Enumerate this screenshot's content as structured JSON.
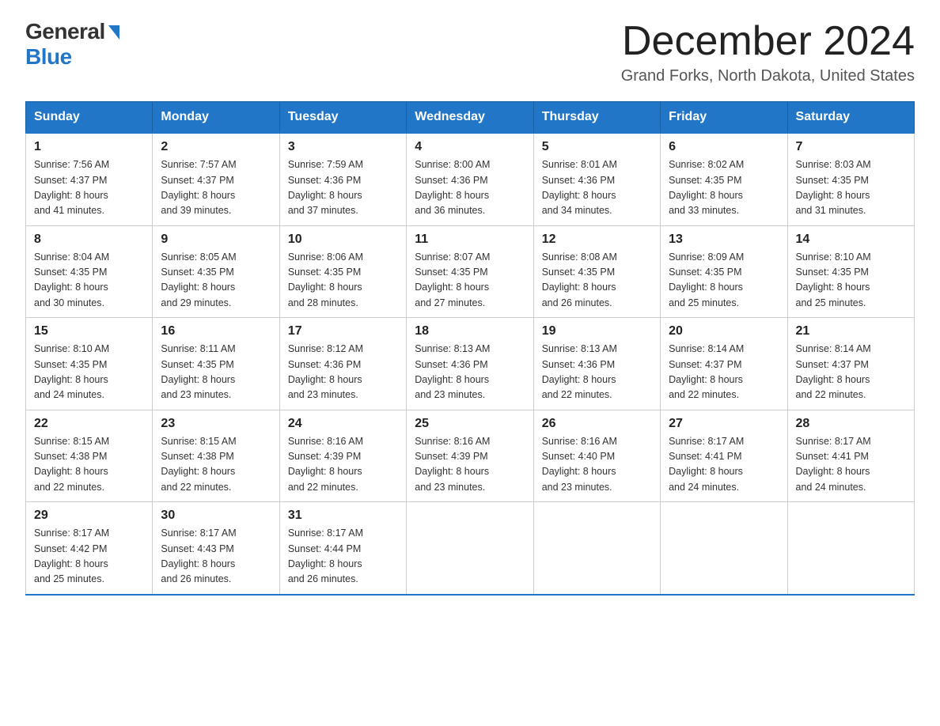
{
  "logo": {
    "general": "General",
    "blue": "Blue"
  },
  "header": {
    "month": "December 2024",
    "location": "Grand Forks, North Dakota, United States"
  },
  "days": [
    "Sunday",
    "Monday",
    "Tuesday",
    "Wednesday",
    "Thursday",
    "Friday",
    "Saturday"
  ],
  "weeks": [
    [
      {
        "day": "1",
        "sunrise": "7:56 AM",
        "sunset": "4:37 PM",
        "daylight": "8 hours and 41 minutes."
      },
      {
        "day": "2",
        "sunrise": "7:57 AM",
        "sunset": "4:37 PM",
        "daylight": "8 hours and 39 minutes."
      },
      {
        "day": "3",
        "sunrise": "7:59 AM",
        "sunset": "4:36 PM",
        "daylight": "8 hours and 37 minutes."
      },
      {
        "day": "4",
        "sunrise": "8:00 AM",
        "sunset": "4:36 PM",
        "daylight": "8 hours and 36 minutes."
      },
      {
        "day": "5",
        "sunrise": "8:01 AM",
        "sunset": "4:36 PM",
        "daylight": "8 hours and 34 minutes."
      },
      {
        "day": "6",
        "sunrise": "8:02 AM",
        "sunset": "4:35 PM",
        "daylight": "8 hours and 33 minutes."
      },
      {
        "day": "7",
        "sunrise": "8:03 AM",
        "sunset": "4:35 PM",
        "daylight": "8 hours and 31 minutes."
      }
    ],
    [
      {
        "day": "8",
        "sunrise": "8:04 AM",
        "sunset": "4:35 PM",
        "daylight": "8 hours and 30 minutes."
      },
      {
        "day": "9",
        "sunrise": "8:05 AM",
        "sunset": "4:35 PM",
        "daylight": "8 hours and 29 minutes."
      },
      {
        "day": "10",
        "sunrise": "8:06 AM",
        "sunset": "4:35 PM",
        "daylight": "8 hours and 28 minutes."
      },
      {
        "day": "11",
        "sunrise": "8:07 AM",
        "sunset": "4:35 PM",
        "daylight": "8 hours and 27 minutes."
      },
      {
        "day": "12",
        "sunrise": "8:08 AM",
        "sunset": "4:35 PM",
        "daylight": "8 hours and 26 minutes."
      },
      {
        "day": "13",
        "sunrise": "8:09 AM",
        "sunset": "4:35 PM",
        "daylight": "8 hours and 25 minutes."
      },
      {
        "day": "14",
        "sunrise": "8:10 AM",
        "sunset": "4:35 PM",
        "daylight": "8 hours and 25 minutes."
      }
    ],
    [
      {
        "day": "15",
        "sunrise": "8:10 AM",
        "sunset": "4:35 PM",
        "daylight": "8 hours and 24 minutes."
      },
      {
        "day": "16",
        "sunrise": "8:11 AM",
        "sunset": "4:35 PM",
        "daylight": "8 hours and 23 minutes."
      },
      {
        "day": "17",
        "sunrise": "8:12 AM",
        "sunset": "4:36 PM",
        "daylight": "8 hours and 23 minutes."
      },
      {
        "day": "18",
        "sunrise": "8:13 AM",
        "sunset": "4:36 PM",
        "daylight": "8 hours and 23 minutes."
      },
      {
        "day": "19",
        "sunrise": "8:13 AM",
        "sunset": "4:36 PM",
        "daylight": "8 hours and 22 minutes."
      },
      {
        "day": "20",
        "sunrise": "8:14 AM",
        "sunset": "4:37 PM",
        "daylight": "8 hours and 22 minutes."
      },
      {
        "day": "21",
        "sunrise": "8:14 AM",
        "sunset": "4:37 PM",
        "daylight": "8 hours and 22 minutes."
      }
    ],
    [
      {
        "day": "22",
        "sunrise": "8:15 AM",
        "sunset": "4:38 PM",
        "daylight": "8 hours and 22 minutes."
      },
      {
        "day": "23",
        "sunrise": "8:15 AM",
        "sunset": "4:38 PM",
        "daylight": "8 hours and 22 minutes."
      },
      {
        "day": "24",
        "sunrise": "8:16 AM",
        "sunset": "4:39 PM",
        "daylight": "8 hours and 22 minutes."
      },
      {
        "day": "25",
        "sunrise": "8:16 AM",
        "sunset": "4:39 PM",
        "daylight": "8 hours and 23 minutes."
      },
      {
        "day": "26",
        "sunrise": "8:16 AM",
        "sunset": "4:40 PM",
        "daylight": "8 hours and 23 minutes."
      },
      {
        "day": "27",
        "sunrise": "8:17 AM",
        "sunset": "4:41 PM",
        "daylight": "8 hours and 24 minutes."
      },
      {
        "day": "28",
        "sunrise": "8:17 AM",
        "sunset": "4:41 PM",
        "daylight": "8 hours and 24 minutes."
      }
    ],
    [
      {
        "day": "29",
        "sunrise": "8:17 AM",
        "sunset": "4:42 PM",
        "daylight": "8 hours and 25 minutes."
      },
      {
        "day": "30",
        "sunrise": "8:17 AM",
        "sunset": "4:43 PM",
        "daylight": "8 hours and 26 minutes."
      },
      {
        "day": "31",
        "sunrise": "8:17 AM",
        "sunset": "4:44 PM",
        "daylight": "8 hours and 26 minutes."
      },
      null,
      null,
      null,
      null
    ]
  ],
  "labels": {
    "sunrise": "Sunrise:",
    "sunset": "Sunset:",
    "daylight": "Daylight:"
  }
}
